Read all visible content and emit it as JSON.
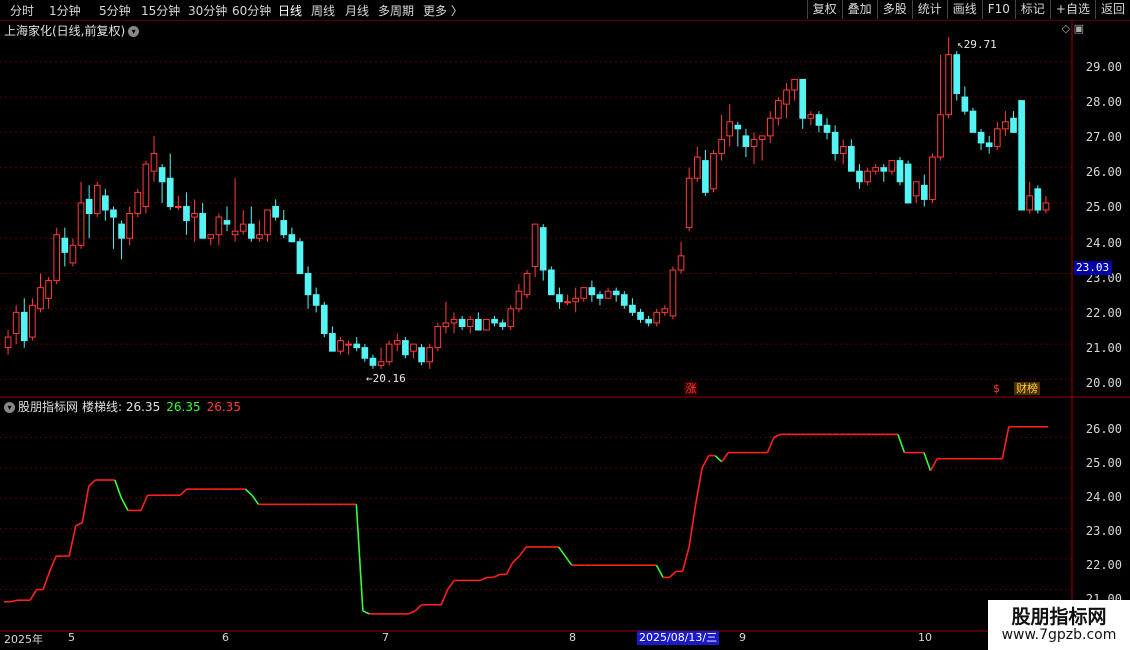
{
  "toolbar": {
    "periods": [
      "分时",
      "1分钟",
      "5分钟",
      "15分钟",
      "30分钟",
      "60分钟",
      "日线",
      "周线",
      "月线",
      "多周期",
      "更多 〉"
    ],
    "active_period": "日线",
    "buttons": [
      "复权",
      "叠加",
      "多股",
      "统计",
      "画线",
      "F10",
      "标记",
      "+自选",
      "返回"
    ]
  },
  "main_chart": {
    "title": "上海家化(日线,前复权)",
    "price_axis_labels": [
      "29.00",
      "28.00",
      "27.00",
      "26.00",
      "25.00",
      "24.00",
      "23.00",
      "22.00",
      "21.00",
      "20.00"
    ],
    "current_price": "23.03",
    "high_annotation": "29.71",
    "low_annotation": "20.16",
    "markers": {
      "zhang": "涨",
      "dollar": "$",
      "caibang": "财榜"
    },
    "colors": {
      "up": "#ff3b3b",
      "down": "#54f4f4",
      "grid": "#5a0000"
    }
  },
  "indicator": {
    "name": "股朋指标网",
    "line_label": "楼梯线: 26.35",
    "value_green": "26.35",
    "value_red": "26.35",
    "axis_labels": [
      "26.00",
      "25.00",
      "24.00",
      "23.00",
      "22.00",
      "21.00"
    ],
    "colors": {
      "rise": "#ff2020",
      "fall": "#33ff33"
    }
  },
  "time_axis": {
    "labels": [
      "2025年",
      "5",
      "6",
      "7",
      "8",
      "9",
      "10"
    ],
    "cursor_date": "2025/08/13/三"
  },
  "watermark": {
    "line1": "股朋指标网",
    "line2": "www.7gpzb.com"
  },
  "chart_data": {
    "type": "candlestick",
    "title": "上海家化(日线,前复权)",
    "ylim": [
      19.7,
      29.9
    ],
    "ohlc": [
      [
        20.9,
        21.4,
        20.7,
        21.2
      ],
      [
        21.3,
        22.1,
        21.0,
        21.9
      ],
      [
        21.9,
        22.3,
        20.9,
        21.1
      ],
      [
        21.2,
        22.3,
        21.1,
        22.1
      ],
      [
        22.0,
        23.0,
        21.9,
        22.6
      ],
      [
        22.3,
        22.9,
        22.0,
        22.8
      ],
      [
        22.8,
        24.3,
        22.7,
        24.1
      ],
      [
        24.0,
        24.3,
        23.2,
        23.6
      ],
      [
        23.3,
        24.0,
        23.2,
        23.8
      ],
      [
        23.8,
        25.6,
        23.7,
        25.0
      ],
      [
        25.1,
        25.5,
        24.0,
        24.7
      ],
      [
        24.7,
        25.6,
        24.6,
        25.5
      ],
      [
        25.2,
        25.4,
        24.5,
        24.8
      ],
      [
        24.8,
        24.9,
        23.7,
        24.6
      ],
      [
        24.4,
        24.5,
        23.4,
        24.0
      ],
      [
        24.0,
        24.9,
        23.8,
        24.7
      ],
      [
        24.7,
        25.4,
        24.6,
        25.3
      ],
      [
        24.9,
        26.2,
        24.7,
        26.1
      ],
      [
        25.9,
        26.9,
        25.6,
        26.4
      ],
      [
        26.0,
        26.1,
        25.0,
        25.6
      ],
      [
        25.7,
        26.4,
        24.8,
        24.9
      ],
      [
        24.9,
        25.2,
        24.8,
        24.9
      ],
      [
        24.9,
        25.3,
        24.1,
        24.5
      ],
      [
        24.6,
        25.1,
        23.9,
        24.7
      ],
      [
        24.7,
        25.0,
        24.0,
        24.0
      ],
      [
        24.0,
        24.1,
        23.8,
        24.1
      ],
      [
        24.1,
        24.7,
        23.8,
        24.6
      ],
      [
        24.5,
        24.9,
        24.2,
        24.4
      ],
      [
        24.1,
        25.7,
        23.9,
        24.2
      ],
      [
        24.2,
        24.8,
        24.1,
        24.4
      ],
      [
        24.4,
        24.9,
        23.9,
        24.0
      ],
      [
        24.0,
        24.5,
        23.9,
        24.1
      ],
      [
        24.1,
        24.8,
        23.9,
        24.8
      ],
      [
        24.9,
        25.1,
        24.5,
        24.6
      ],
      [
        24.5,
        24.8,
        24.0,
        24.1
      ],
      [
        24.1,
        24.3,
        23.9,
        23.9
      ],
      [
        23.9,
        24.0,
        23.0,
        23.0
      ],
      [
        23.0,
        23.2,
        22.0,
        22.4
      ],
      [
        22.4,
        22.6,
        21.9,
        22.1
      ],
      [
        22.1,
        22.2,
        21.2,
        21.3
      ],
      [
        21.3,
        21.5,
        20.8,
        20.8
      ],
      [
        20.8,
        21.2,
        20.7,
        21.1
      ],
      [
        21.0,
        21.1,
        20.7,
        21.0
      ],
      [
        21.0,
        21.2,
        20.8,
        20.9
      ],
      [
        20.9,
        21.0,
        20.5,
        20.6
      ],
      [
        20.6,
        20.7,
        20.3,
        20.4
      ],
      [
        20.4,
        20.9,
        20.3,
        20.5
      ],
      [
        20.5,
        21.1,
        20.4,
        21.0
      ],
      [
        21.0,
        21.3,
        20.8,
        21.1
      ],
      [
        21.1,
        21.2,
        20.6,
        20.7
      ],
      [
        20.8,
        21.0,
        20.6,
        21.0
      ],
      [
        20.9,
        21.0,
        20.4,
        20.5
      ],
      [
        20.5,
        21.0,
        20.3,
        20.9
      ],
      [
        20.9,
        21.6,
        20.8,
        21.5
      ],
      [
        21.5,
        22.2,
        21.3,
        21.6
      ],
      [
        21.6,
        21.9,
        21.3,
        21.7
      ],
      [
        21.7,
        21.8,
        21.4,
        21.5
      ],
      [
        21.5,
        21.8,
        21.3,
        21.7
      ],
      [
        21.7,
        21.9,
        21.4,
        21.4
      ],
      [
        21.4,
        21.7,
        21.4,
        21.7
      ],
      [
        21.7,
        21.8,
        21.5,
        21.6
      ],
      [
        21.6,
        21.7,
        21.4,
        21.5
      ],
      [
        21.5,
        22.1,
        21.4,
        22.0
      ],
      [
        22.0,
        22.7,
        21.9,
        22.5
      ],
      [
        22.4,
        23.1,
        22.3,
        23.0
      ],
      [
        23.2,
        24.4,
        22.9,
        24.4
      ],
      [
        24.3,
        24.4,
        22.8,
        23.1
      ],
      [
        23.1,
        23.2,
        22.5,
        22.4
      ],
      [
        22.4,
        22.6,
        22.0,
        22.2
      ],
      [
        22.2,
        22.4,
        22.1,
        22.2
      ],
      [
        22.2,
        22.6,
        21.9,
        22.3
      ],
      [
        22.3,
        22.6,
        22.2,
        22.6
      ],
      [
        22.6,
        22.8,
        22.2,
        22.4
      ],
      [
        22.4,
        22.5,
        22.1,
        22.3
      ],
      [
        22.3,
        22.6,
        22.3,
        22.5
      ],
      [
        22.5,
        22.6,
        22.2,
        22.4
      ],
      [
        22.4,
        22.5,
        22.0,
        22.1
      ],
      [
        22.1,
        22.3,
        21.8,
        21.9
      ],
      [
        21.9,
        22.0,
        21.6,
        21.7
      ],
      [
        21.7,
        21.8,
        21.5,
        21.6
      ],
      [
        21.6,
        22.0,
        21.5,
        21.9
      ],
      [
        21.9,
        22.1,
        21.8,
        22.0
      ],
      [
        21.8,
        23.2,
        21.7,
        23.1
      ],
      [
        23.1,
        23.9,
        23.0,
        23.5
      ],
      [
        24.3,
        26.0,
        24.2,
        25.7
      ],
      [
        25.7,
        26.6,
        25.6,
        26.3
      ],
      [
        26.2,
        26.5,
        25.2,
        25.3
      ],
      [
        25.4,
        26.5,
        25.3,
        26.4
      ],
      [
        26.4,
        27.5,
        26.2,
        26.8
      ],
      [
        26.9,
        27.8,
        26.6,
        27.3
      ],
      [
        27.2,
        27.3,
        26.6,
        27.1
      ],
      [
        26.9,
        27.1,
        26.3,
        26.6
      ],
      [
        26.6,
        27.0,
        26.1,
        26.8
      ],
      [
        26.8,
        26.9,
        26.2,
        26.9
      ],
      [
        26.9,
        27.6,
        26.7,
        27.4
      ],
      [
        27.4,
        28.0,
        27.2,
        27.9
      ],
      [
        27.8,
        28.4,
        27.4,
        28.2
      ],
      [
        28.2,
        28.5,
        27.9,
        28.5
      ],
      [
        28.5,
        28.5,
        27.1,
        27.4
      ],
      [
        27.4,
        27.6,
        27.2,
        27.5
      ],
      [
        27.5,
        27.6,
        27.0,
        27.2
      ],
      [
        27.2,
        27.4,
        26.8,
        27.0
      ],
      [
        27.0,
        27.2,
        26.2,
        26.4
      ],
      [
        26.4,
        26.8,
        26.1,
        26.6
      ],
      [
        26.6,
        26.8,
        25.9,
        25.9
      ],
      [
        25.9,
        26.1,
        25.4,
        25.6
      ],
      [
        25.6,
        26.0,
        25.5,
        25.9
      ],
      [
        25.9,
        26.1,
        25.8,
        26.0
      ],
      [
        26.0,
        26.1,
        25.6,
        25.9
      ],
      [
        25.9,
        26.2,
        25.8,
        26.2
      ],
      [
        26.2,
        26.3,
        25.5,
        25.6
      ],
      [
        26.1,
        26.2,
        25.0,
        25.0
      ],
      [
        25.2,
        25.6,
        25.0,
        25.6
      ],
      [
        25.5,
        25.8,
        24.9,
        25.1
      ],
      [
        25.1,
        26.4,
        25.0,
        26.3
      ],
      [
        26.3,
        29.2,
        26.2,
        27.5
      ],
      [
        27.5,
        29.7,
        27.4,
        29.2
      ],
      [
        29.2,
        29.3,
        27.9,
        28.1
      ],
      [
        28.0,
        28.3,
        27.5,
        27.6
      ],
      [
        27.6,
        27.7,
        27.0,
        27.0
      ],
      [
        27.0,
        27.1,
        26.5,
        26.7
      ],
      [
        26.7,
        26.9,
        26.4,
        26.6
      ],
      [
        26.6,
        27.3,
        26.5,
        27.1
      ],
      [
        27.1,
        27.6,
        26.9,
        27.3
      ],
      [
        27.4,
        27.6,
        27.1,
        27.0
      ],
      [
        27.9,
        27.9,
        24.8,
        24.8
      ],
      [
        24.8,
        25.6,
        24.7,
        25.2
      ],
      [
        25.4,
        25.5,
        24.7,
        24.8
      ],
      [
        24.8,
        25.2,
        24.7,
        25.0
      ]
    ],
    "indicator_series": {
      "name": "楼梯线",
      "values": [
        20.6,
        20.6,
        20.65,
        20.65,
        20.65,
        21.0,
        21.0,
        21.6,
        22.1,
        22.1,
        22.1,
        23.1,
        23.2,
        24.4,
        24.6,
        24.6,
        24.6,
        24.6,
        24.0,
        23.6,
        23.6,
        23.6,
        24.1,
        24.1,
        24.1,
        24.1,
        24.1,
        24.1,
        24.3,
        24.3,
        24.3,
        24.3,
        24.3,
        24.3,
        24.3,
        24.3,
        24.3,
        24.3,
        24.1,
        23.8,
        23.8,
        23.8,
        23.8,
        23.8,
        23.8,
        23.8,
        23.8,
        23.8,
        23.8,
        23.8,
        23.8,
        23.8,
        23.8,
        23.8,
        23.8,
        20.3,
        20.2,
        20.2,
        20.2,
        20.2,
        20.2,
        20.2,
        20.2,
        20.3,
        20.5,
        20.5,
        20.5,
        20.5,
        21.0,
        21.3,
        21.3,
        21.3,
        21.3,
        21.3,
        21.4,
        21.4,
        21.5,
        21.5,
        21.9,
        22.1,
        22.4,
        22.4,
        22.4,
        22.4,
        22.4,
        22.4,
        22.1,
        21.8,
        21.8,
        21.8,
        21.8,
        21.8,
        21.8,
        21.8,
        21.8,
        21.8,
        21.8,
        21.8,
        21.8,
        21.8,
        21.8,
        21.4,
        21.4,
        21.6,
        21.6,
        22.4,
        23.8,
        25.0,
        25.4,
        25.4,
        25.2,
        25.5,
        25.5,
        25.5,
        25.5,
        25.5,
        25.5,
        25.5,
        26.0,
        26.1,
        26.1,
        26.1,
        26.1,
        26.1,
        26.1,
        26.1,
        26.1,
        26.1,
        26.1,
        26.1,
        26.1,
        26.1,
        26.1,
        26.1,
        26.1,
        26.1,
        26.1,
        26.1,
        25.5,
        25.5,
        25.5,
        25.5,
        24.9,
        25.3,
        25.3,
        25.3,
        25.3,
        25.3,
        25.3,
        25.3,
        25.3,
        25.3,
        25.3,
        25.3,
        26.35,
        26.35,
        26.35,
        26.35,
        26.35,
        26.35,
        26.35
      ],
      "ylim": [
        20.0,
        26.9
      ]
    }
  }
}
